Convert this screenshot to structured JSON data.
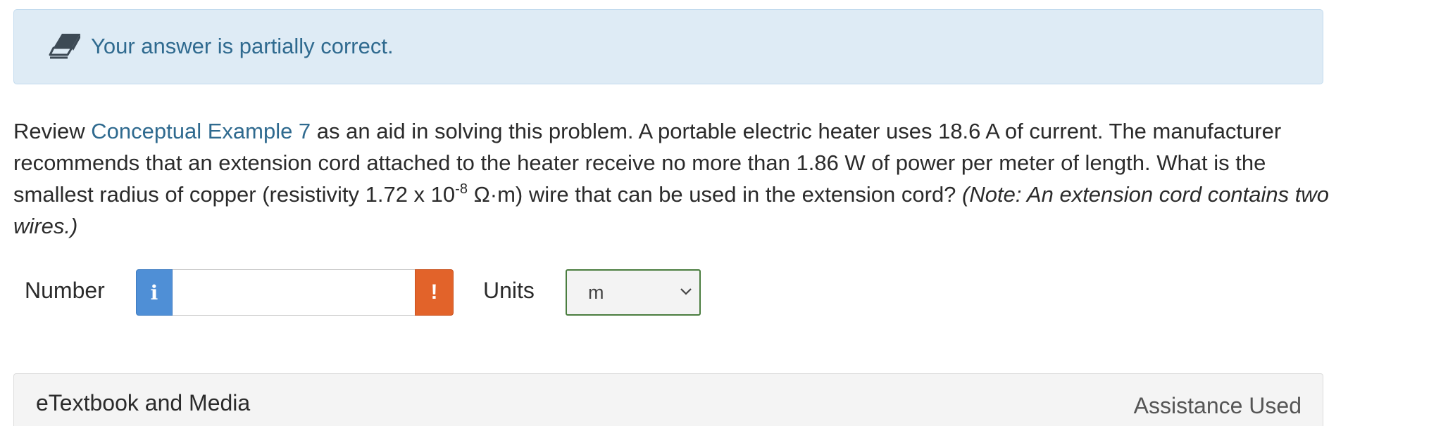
{
  "feedback": {
    "icon": "eraser-icon",
    "message": "Your answer is partially correct."
  },
  "question": {
    "intro": "Review ",
    "link_text": "Conceptual Example 7",
    "body_part1": " as an aid in solving this problem. A portable electric heater uses 18.6 A of current. The manufacturer recommends that an extension cord attached to the heater receive no more than 1.86 W of power per meter of length. What is the smallest radius of copper (resistivity 1.72 x 10",
    "exponent": "-8",
    "body_part2": " Ω·m) wire that can be used in the extension cord? ",
    "note": "(Note: An extension cord contains two wires.)"
  },
  "answer": {
    "number_label": "Number",
    "info_glyph": "i",
    "number_value": "",
    "alert_glyph": "!",
    "units_label": "Units",
    "units_selected": "m"
  },
  "etextbook": {
    "title": "eTextbook and Media",
    "assistance": "Assistance Used"
  },
  "colors": {
    "feedback_bg": "#deebf5",
    "link": "#2f6a8f",
    "info_button": "#4f8fd6",
    "alert_button": "#e2632a",
    "select_border": "#4a7d3f"
  }
}
